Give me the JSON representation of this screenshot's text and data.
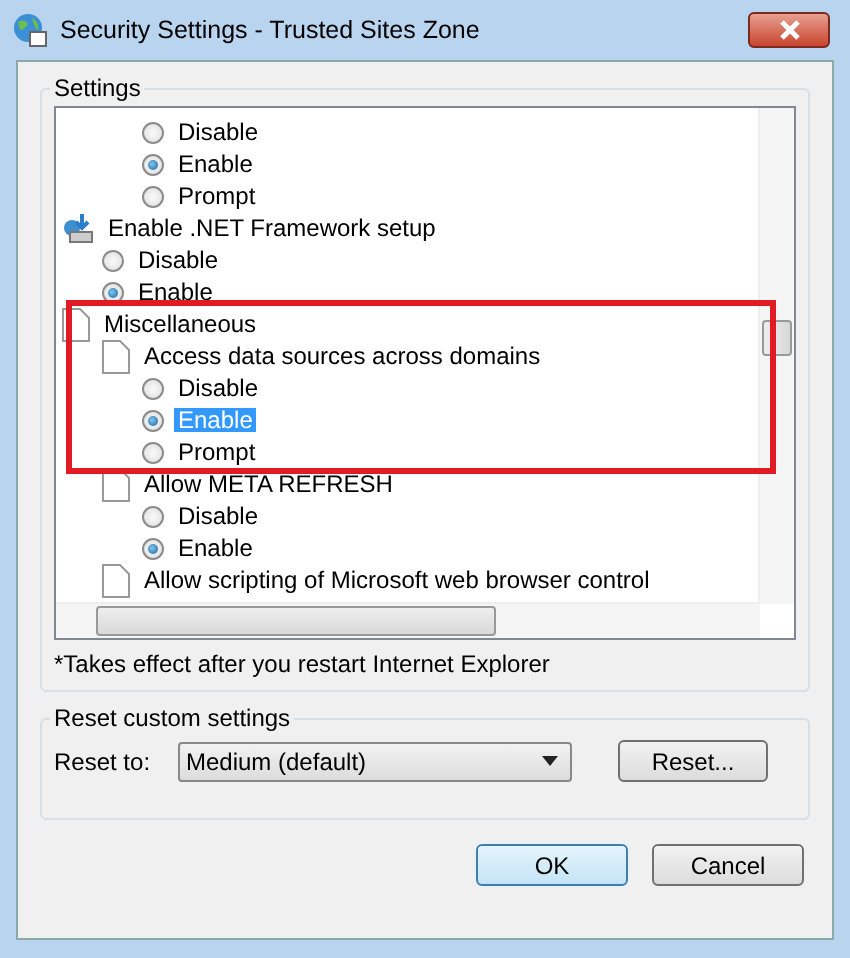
{
  "window": {
    "title": "Security Settings - Trusted Sites Zone"
  },
  "settings": {
    "title": "Settings",
    "items": [
      {
        "kind": "offscreen",
        "children": [
          {
            "kind": "offscreen",
            "children": [
              {
                "kind": "option",
                "label": "Disable",
                "checked": false,
                "selected": false
              },
              {
                "kind": "option",
                "label": "Enable",
                "checked": true,
                "selected": false
              },
              {
                "kind": "option",
                "label": "Prompt",
                "checked": false,
                "selected": false
              }
            ]
          }
        ]
      },
      {
        "kind": "installer",
        "label": "Enable .NET Framework setup",
        "children": [
          {
            "kind": "option",
            "label": "Disable",
            "checked": false,
            "selected": false
          },
          {
            "kind": "option",
            "label": "Enable",
            "checked": true,
            "selected": false
          }
        ]
      },
      {
        "kind": "document",
        "label": "Miscellaneous",
        "children": [
          {
            "kind": "document",
            "label": "Access data sources across domains",
            "children": [
              {
                "kind": "option",
                "label": "Disable",
                "checked": false,
                "selected": false
              },
              {
                "kind": "option",
                "label": "Enable",
                "checked": true,
                "selected": true
              },
              {
                "kind": "option",
                "label": "Prompt",
                "checked": false,
                "selected": false
              }
            ]
          },
          {
            "kind": "document",
            "label": "Allow META REFRESH",
            "children": [
              {
                "kind": "option",
                "label": "Disable",
                "checked": false,
                "selected": false
              },
              {
                "kind": "option",
                "label": "Enable",
                "checked": true,
                "selected": false
              }
            ]
          },
          {
            "kind": "document",
            "label": "Allow scripting of Microsoft web browser control"
          }
        ]
      }
    ],
    "note": "*Takes effect after you restart Internet Explorer"
  },
  "reset": {
    "title": "Reset custom settings",
    "label": "Reset to:",
    "value": "Medium (default)",
    "button": "Reset..."
  },
  "buttons": [
    "OK",
    "Cancel"
  ]
}
